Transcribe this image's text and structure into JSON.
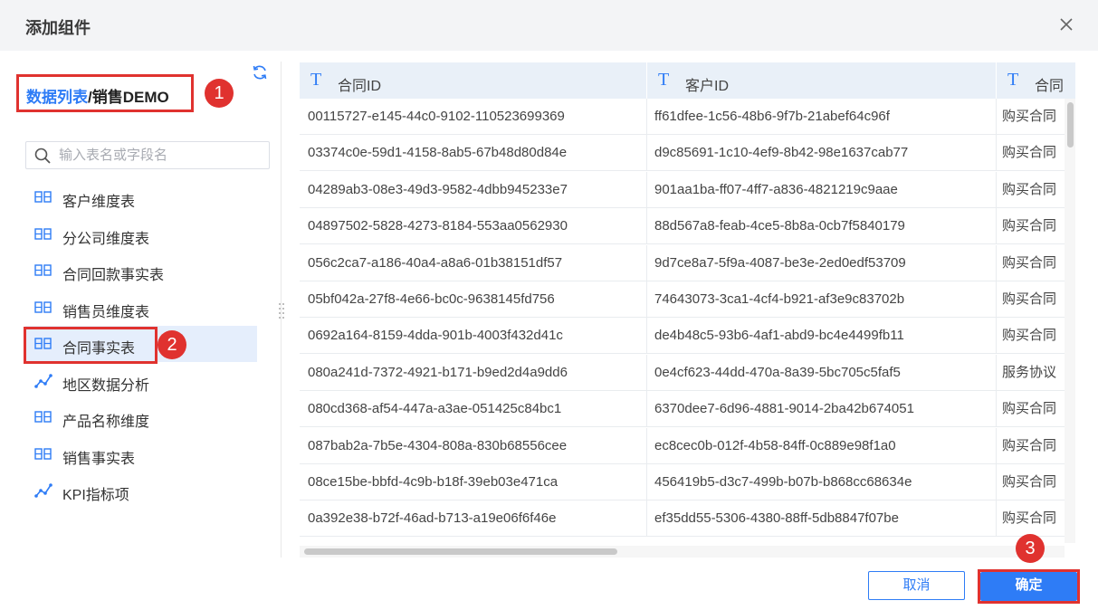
{
  "dialog": {
    "title": "添加组件"
  },
  "breadcrumb": {
    "link": "数据列表",
    "sep": "/",
    "current": "销售DEMO"
  },
  "badges": [
    "1",
    "2",
    "3"
  ],
  "search": {
    "placeholder": "输入表名或字段名"
  },
  "tree": [
    {
      "label": "客户维度表",
      "icon": "table-icon"
    },
    {
      "label": "分公司维度表",
      "icon": "table-icon"
    },
    {
      "label": "合同回款事实表",
      "icon": "table-icon"
    },
    {
      "label": "销售员维度表",
      "icon": "table-icon"
    },
    {
      "label": "合同事实表",
      "icon": "table-icon",
      "selected": true
    },
    {
      "label": "地区数据分析",
      "icon": "analysis-icon"
    },
    {
      "label": "产品名称维度",
      "icon": "table-icon"
    },
    {
      "label": "销售事实表",
      "icon": "table-icon"
    },
    {
      "label": "KPI指标项",
      "icon": "analysis-icon"
    }
  ],
  "table": {
    "type_glyph": "T",
    "columns": [
      "合同ID",
      "客户ID",
      "合同"
    ],
    "rows": [
      [
        "00115727-e145-44c0-9102-110523699369",
        "ff61dfee-1c56-48b6-9f7b-21abef64c96f",
        "购买合同"
      ],
      [
        "03374c0e-59d1-4158-8ab5-67b48d80d84e",
        "d9c85691-1c10-4ef9-8b42-98e1637cab77",
        "购买合同"
      ],
      [
        "04289ab3-08e3-49d3-9582-4dbb945233e7",
        "901aa1ba-ff07-4ff7-a836-4821219c9aae",
        "购买合同"
      ],
      [
        "04897502-5828-4273-8184-553aa0562930",
        "88d567a8-feab-4ce5-8b8a-0cb7f5840179",
        "购买合同"
      ],
      [
        "056c2ca7-a186-40a4-a8a6-01b38151df57",
        "9d7ce8a7-5f9a-4087-be3e-2ed0edf53709",
        "购买合同"
      ],
      [
        "05bf042a-27f8-4e66-bc0c-9638145fd756",
        "74643073-3ca1-4cf4-b921-af3e9c83702b",
        "购买合同"
      ],
      [
        "0692a164-8159-4dda-901b-4003f432d41c",
        "de4b48c5-93b6-4af1-abd9-bc4e4499fb11",
        "购买合同"
      ],
      [
        "080a241d-7372-4921-b171-b9ed2d4a9dd6",
        "0e4cf623-44dd-470a-8a39-5bc705c5faf5",
        "服务协议"
      ],
      [
        "080cd368-af54-447a-a3ae-051425c84bc1",
        "6370dee7-6d96-4881-9014-2ba42b674051",
        "购买合同"
      ],
      [
        "087bab2a-7b5e-4304-808a-830b68556cee",
        "ec8cec0b-012f-4b58-84ff-0c889e98f1a0",
        "购买合同"
      ],
      [
        "08ce15be-bbfd-4c9b-b18f-39eb03e471ca",
        "456419b5-d3c7-499b-b07b-b868cc68634e",
        "购买合同"
      ],
      [
        "0a392e38-b72f-46ad-b713-a19e06f6f46e",
        "ef35dd55-5306-4380-88ff-5db8847f07be",
        "购买合同"
      ]
    ]
  },
  "footer": {
    "cancel": "取消",
    "ok": "确定"
  },
  "colors": {
    "primary": "#2e7cf6",
    "highlight": "#e0322f",
    "selected_bg": "#e5eefc",
    "header_bg": "#e9f0f8"
  }
}
